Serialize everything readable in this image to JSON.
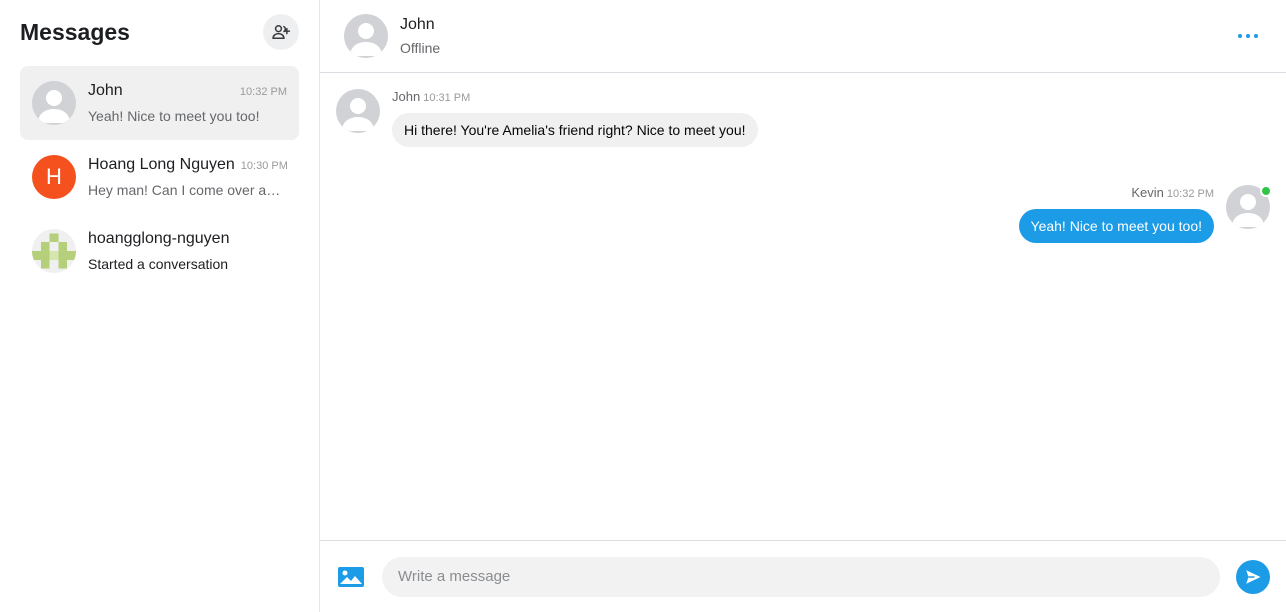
{
  "sidebar": {
    "title": "Messages",
    "add_icon": "add-user-icon",
    "conversations": [
      {
        "name": "John",
        "time": "10:32 PM",
        "preview": "Yeah! Nice to meet you too!",
        "avatar": "default-user-avatar",
        "active": true
      },
      {
        "name": "Hoang Long Nguyen",
        "time": "10:30 PM",
        "preview": "Hey man! Can I come over and play some games?",
        "avatar_letter": "H",
        "avatar_color": "#f4511e"
      },
      {
        "name": "hoangglong-nguyen",
        "time": "",
        "preview": "Started a conversation",
        "avatar": "identicon-green"
      }
    ]
  },
  "header": {
    "name": "John",
    "status": "Offline",
    "more_icon": "more-dots-icon"
  },
  "messages": {
    "incoming": {
      "sender": "John",
      "time": "10:31 PM",
      "text": "Hi there! You're Amelia's friend right? Nice to meet you!"
    },
    "outgoing": {
      "sender": "Kevin",
      "time": "10:32 PM",
      "text": "Yeah! Nice to meet you too!"
    }
  },
  "composer": {
    "placeholder": "Write a message",
    "image_icon": "image-icon",
    "send_icon": "send-icon"
  },
  "colors": {
    "accent": "#1c9be6",
    "online": "#31c545",
    "identicon": "#b5cf7a"
  }
}
